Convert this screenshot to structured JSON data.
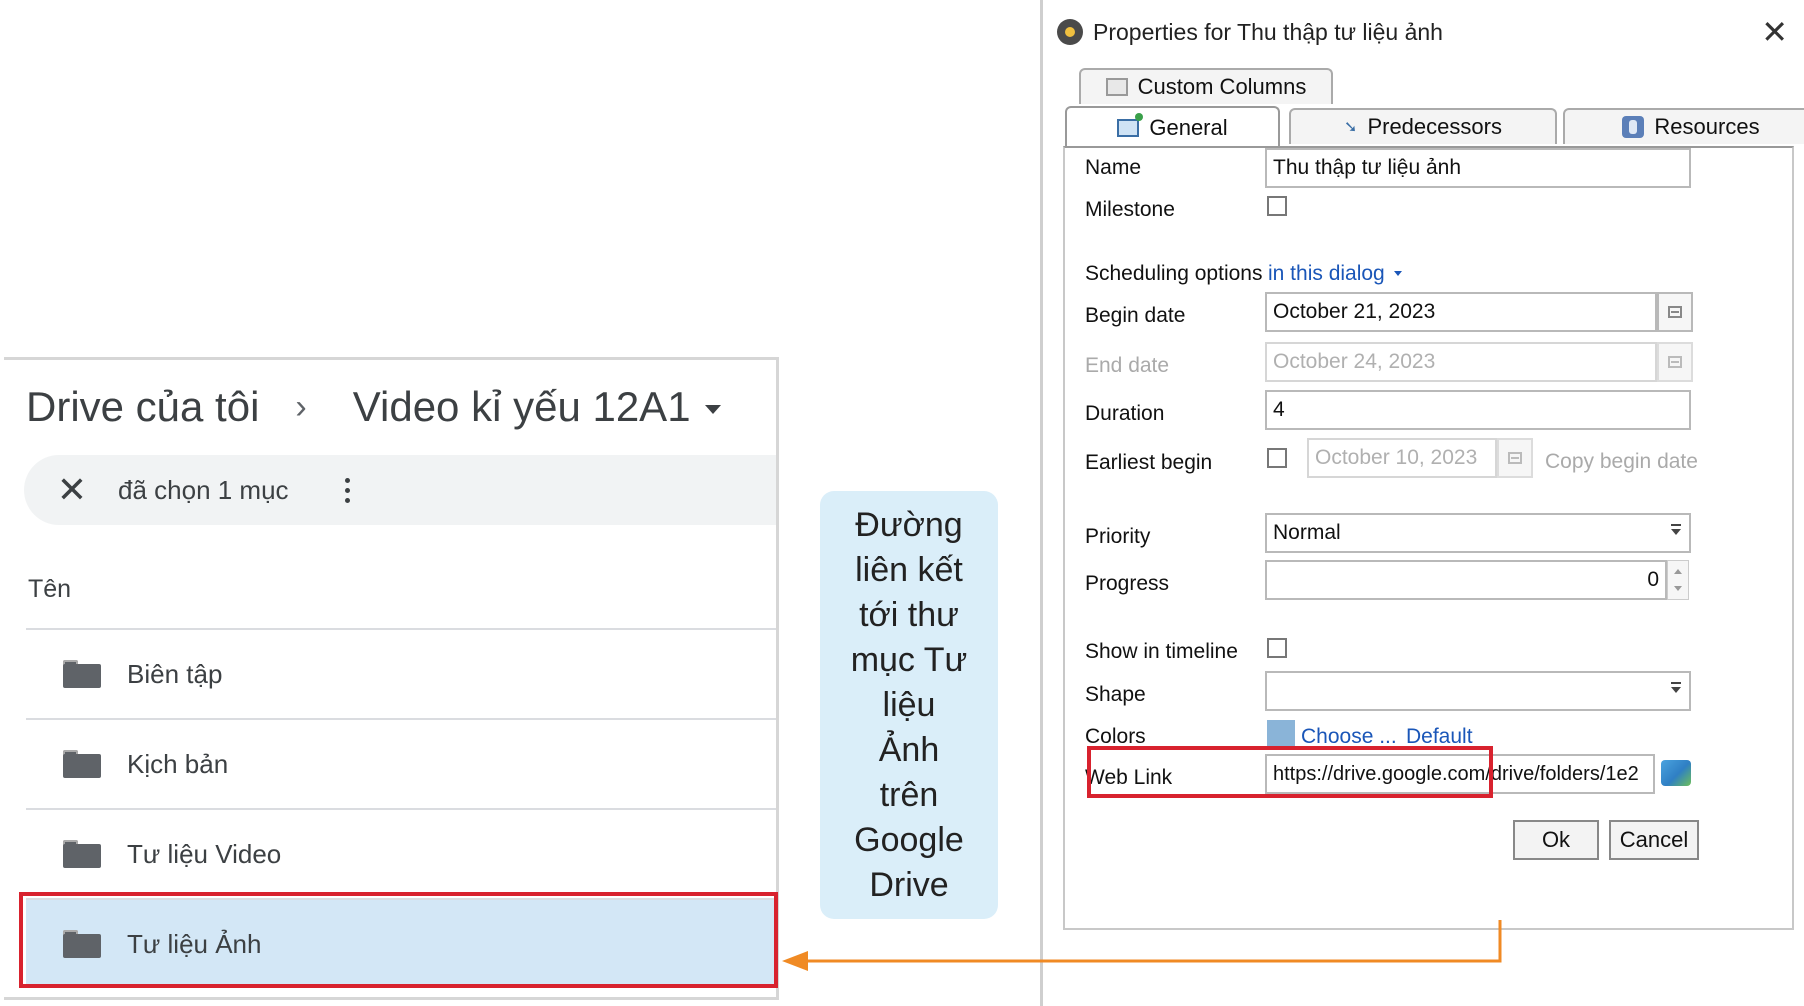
{
  "drive": {
    "breadcrumb_root": "Drive của tôi",
    "breadcrumb_separator": "›",
    "breadcrumb_current": "Video kỉ yếu 12A1",
    "selection_text": "đã chọn 1 mục",
    "column_header": "Tên",
    "items": [
      {
        "name": "Biên tập",
        "selected": false
      },
      {
        "name": "Kịch bản",
        "selected": false
      },
      {
        "name": "Tư liệu Video",
        "selected": false
      },
      {
        "name": "Tư liệu Ảnh",
        "selected": true
      }
    ]
  },
  "callout": {
    "text": "Đường\nliên kết\ntới thư\nmục Tư\nliệu\nẢnh\ntrên\nGoogle\nDrive"
  },
  "dialog": {
    "title": "Properties for Thu thập tư liệu ảnh",
    "tabs": {
      "custom_columns": "Custom Columns",
      "general": "General",
      "predecessors": "Predecessors",
      "resources": "Resources"
    },
    "fields": {
      "name_label": "Name",
      "name_value": "Thu thập tư liệu ảnh",
      "milestone_label": "Milestone",
      "scheduling_label": "Scheduling options",
      "scheduling_value": "in this dialog",
      "begin_label": "Begin date",
      "begin_value": "October 21, 2023",
      "end_label": "End date",
      "end_value": "October 24, 2023",
      "duration_label": "Duration",
      "duration_value": "4",
      "earliest_label": "Earliest begin",
      "earliest_value": "October 10, 2023",
      "copy_begin": "Copy begin date",
      "priority_label": "Priority",
      "priority_value": "Normal",
      "progress_label": "Progress",
      "progress_value": "0",
      "timeline_label": "Show in timeline",
      "shape_label": "Shape",
      "shape_value": "",
      "colors_label": "Colors",
      "colors_choose": "Choose ...",
      "colors_default": "Default",
      "weblink_label": "Web Link",
      "weblink_value": "https://drive.google.com/drive/folders/1e2"
    },
    "buttons": {
      "ok": "Ok",
      "cancel": "Cancel"
    }
  },
  "colors": {
    "highlight_red": "#d8222e",
    "arrow_orange": "#f08a24",
    "selected_row": "#d3e7f6",
    "callout_bg": "#daeef9"
  }
}
